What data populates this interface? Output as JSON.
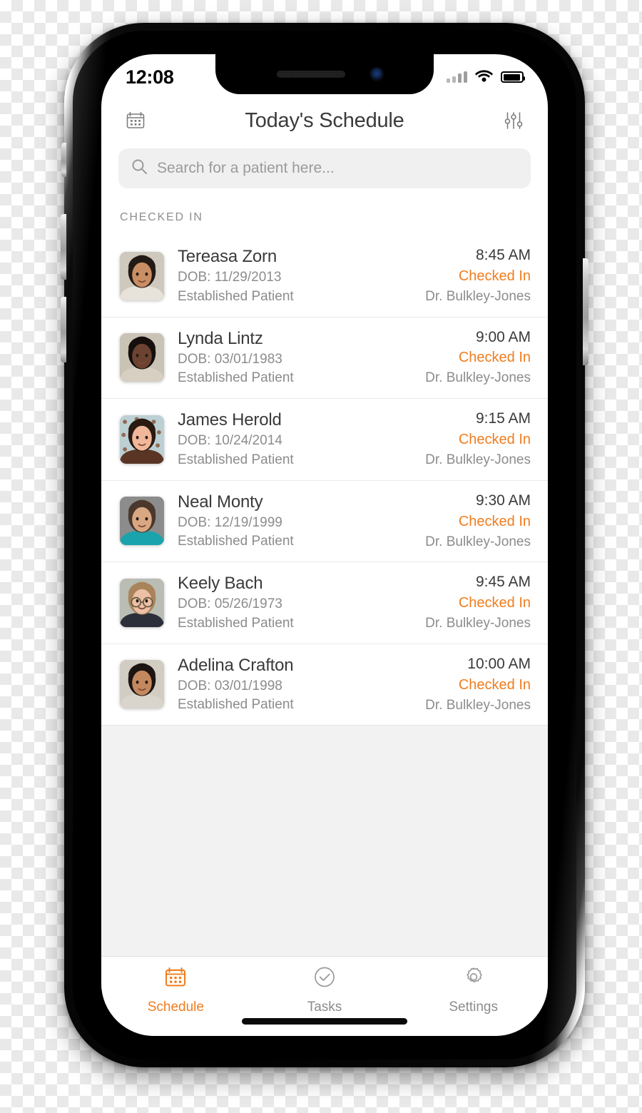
{
  "status_bar": {
    "time": "12:08",
    "signal_icon": "cellular-signal-icon",
    "wifi_icon": "wifi-icon",
    "battery_icon": "battery-icon",
    "battery_level_percent": 92
  },
  "header": {
    "title": "Today's Schedule",
    "left_icon": "calendar-icon",
    "right_icon": "filter-sliders-icon"
  },
  "search": {
    "placeholder": "Search for a patient here...",
    "value": "",
    "icon": "search-icon"
  },
  "section": {
    "label": "CHECKED IN"
  },
  "colors": {
    "accent_orange": "#f07d1e",
    "primary_text": "#3a3a3a",
    "secondary_text": "#8c8c8c",
    "search_background": "#f0f0f0",
    "empty_background": "#f2f2f2",
    "divider": "#e8e8e8"
  },
  "patients": [
    {
      "name": "Tereasa Zorn",
      "dob": "DOB: 11/29/2013",
      "type": "Established Patient",
      "time": "8:45 AM",
      "status": "Checked In",
      "doctor": "Dr. Bulkley-Jones",
      "avatar": "avatar-woman-dark-hair"
    },
    {
      "name": "Lynda Lintz",
      "dob": "DOB: 03/01/1983",
      "type": "Established Patient",
      "time": "9:00 AM",
      "status": "Checked In",
      "doctor": "Dr. Bulkley-Jones",
      "avatar": "avatar-woman-smiling"
    },
    {
      "name": "James Herold",
      "dob": "DOB: 10/24/2014",
      "type": "Established Patient",
      "time": "9:15 AM",
      "status": "Checked In",
      "doctor": "Dr. Bulkley-Jones",
      "avatar": "avatar-child-boy"
    },
    {
      "name": "Neal Monty",
      "dob": "DOB: 12/19/1999",
      "type": "Established Patient",
      "time": "9:30 AM",
      "status": "Checked In",
      "doctor": "Dr. Bulkley-Jones",
      "avatar": "avatar-young-man"
    },
    {
      "name": "Keely Bach",
      "dob": "DOB: 05/26/1973",
      "type": "Established Patient",
      "time": "9:45 AM",
      "status": "Checked In",
      "doctor": "Dr. Bulkley-Jones",
      "avatar": "avatar-woman-glasses"
    },
    {
      "name": "Adelina Crafton",
      "dob": "DOB: 03/01/1998",
      "type": "Established Patient",
      "time": "10:00 AM",
      "status": "Checked In",
      "doctor": "Dr. Bulkley-Jones",
      "avatar": "avatar-woman-dark-hair-2"
    }
  ],
  "tabs": [
    {
      "label": "Schedule",
      "icon": "calendar-icon",
      "active": true
    },
    {
      "label": "Tasks",
      "icon": "check-circle-icon",
      "active": false
    },
    {
      "label": "Settings",
      "icon": "gear-icon",
      "active": false
    }
  ]
}
